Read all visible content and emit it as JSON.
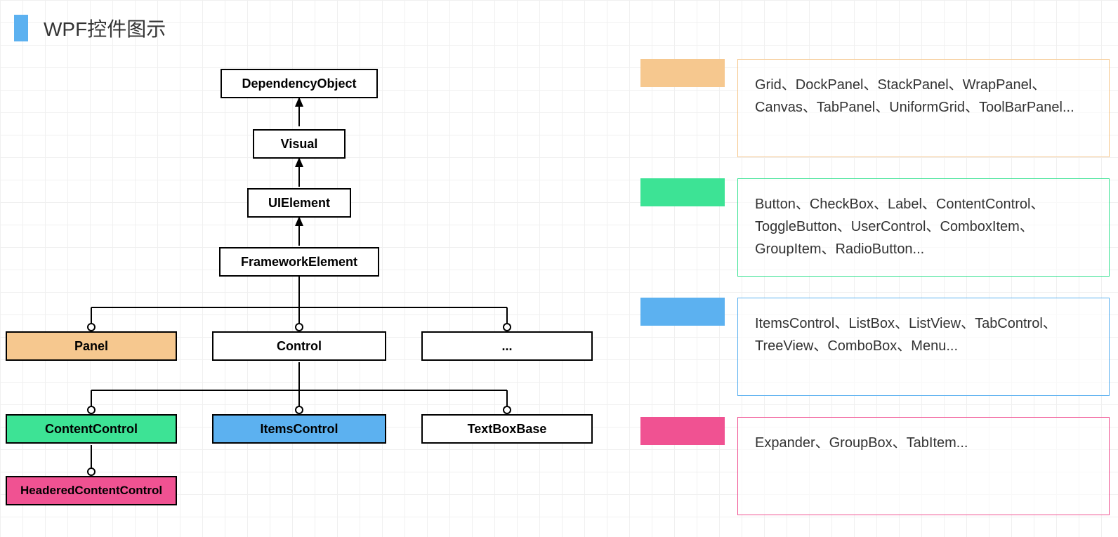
{
  "title": "WPF控件图示",
  "hierarchy": {
    "root": "DependencyObject",
    "l2": "Visual",
    "l3": "UIElement",
    "l4": "FrameworkElement",
    "l5": {
      "panel": "Panel",
      "control": "Control",
      "other": "..."
    },
    "l6": {
      "contentControl": "ContentControl",
      "itemsControl": "ItemsControl",
      "textBoxBase": "TextBoxBase"
    },
    "l7": {
      "headeredContentControl": "HeaderedContentControl"
    }
  },
  "legend": {
    "panel": "Grid、DockPanel、StackPanel、WrapPanel、Canvas、TabPanel、UniformGrid、ToolBarPanel...",
    "contentControl": "Button、CheckBox、Label、ContentControl、ToggleButton、UserControl、ComboxItem、GroupItem、RadioButton...",
    "itemsControl": "ItemsControl、ListBox、ListView、TabControl、TreeView、ComboBox、Menu...",
    "headeredContentControl": "Expander、GroupBox、TabItem..."
  },
  "colors": {
    "panel": "#f6c88f",
    "contentControl": "#3de395",
    "itemsControl": "#5cb1f0",
    "headeredContentControl": "#f05292"
  }
}
